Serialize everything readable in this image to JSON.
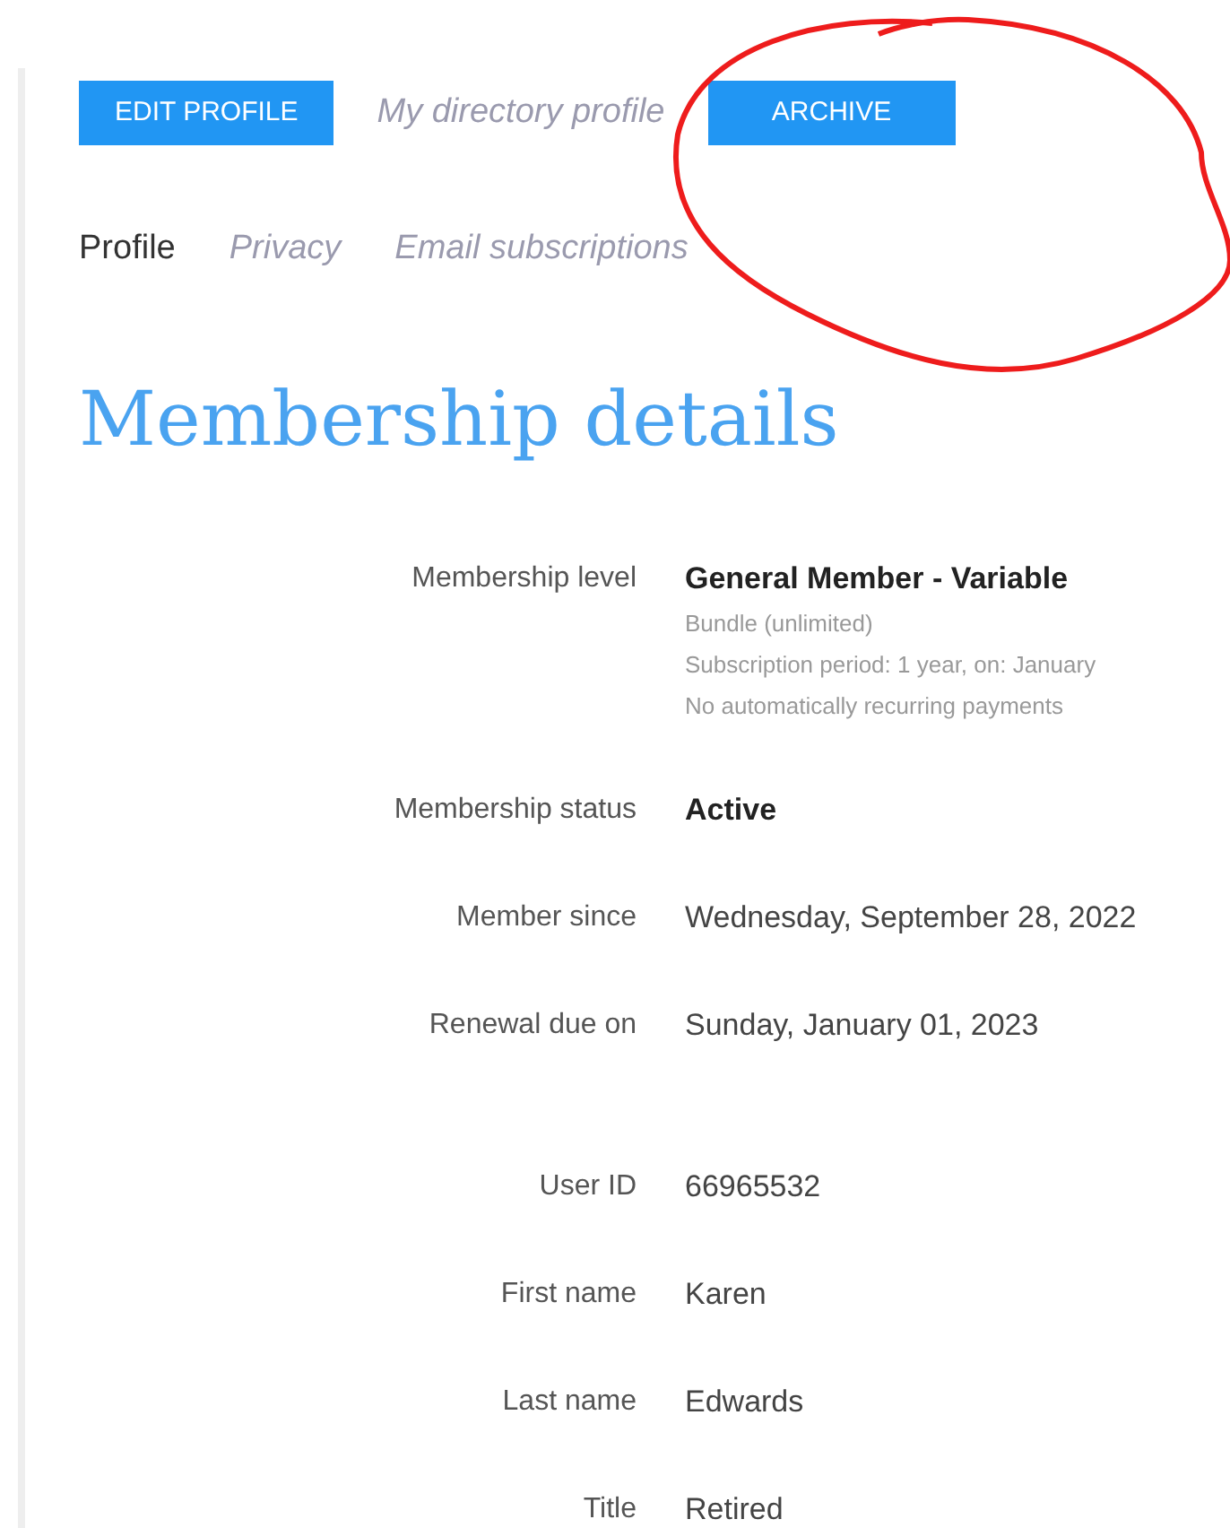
{
  "actions": [
    {
      "kind": "button",
      "label": "EDIT PROFILE"
    },
    {
      "kind": "link",
      "label": "My directory profile"
    },
    {
      "kind": "button",
      "label": "ARCHIVE"
    }
  ],
  "tabs": [
    {
      "label": "Profile",
      "selected": true
    },
    {
      "label": "Privacy",
      "selected": false
    },
    {
      "label": "Email subscriptions",
      "selected": false
    }
  ],
  "heading": "Membership details",
  "field_groups": [
    [
      {
        "label": "Membership level",
        "value": "General Member - Variable",
        "strong": true,
        "notes": [
          "Bundle (unlimited)",
          "Subscription period: 1 year, on: January",
          "No automatically recurring payments"
        ]
      },
      {
        "label": "Membership status",
        "value": "Active",
        "strong": true
      },
      {
        "label": "Member since",
        "value": "Wednesday, September 28, 2022",
        "strong": false
      },
      {
        "label": "Renewal due on",
        "value": "Sunday, January 01, 2023",
        "strong": false
      }
    ],
    [
      {
        "label": "User ID",
        "value": "66965532",
        "strong": false
      },
      {
        "label": "First name",
        "value": "Karen",
        "strong": false
      },
      {
        "label": "Last name",
        "value": "Edwards",
        "strong": false
      },
      {
        "label": "Title",
        "value": "Retired",
        "strong": false
      }
    ]
  ],
  "annotations": [
    {
      "kind": "circle"
    }
  ]
}
